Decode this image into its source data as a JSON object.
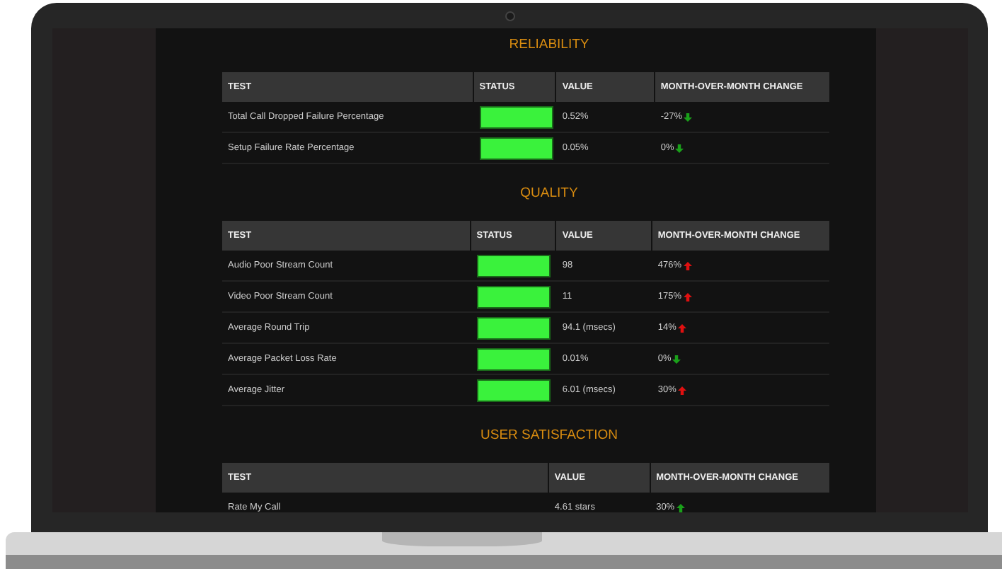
{
  "sections": [
    {
      "title": "RELIABILITY",
      "columns": [
        {
          "label": "TEST",
          "kind": "test"
        },
        {
          "label": "STATUS",
          "kind": "status"
        },
        {
          "label": "VALUE",
          "kind": "value"
        },
        {
          "label": "MONTH-OVER-MONTH CHANGE",
          "kind": "change"
        }
      ],
      "rows": [
        {
          "test": "Total Call Dropped Failure Percentage",
          "passing": true,
          "value": "0.52%",
          "change": "-27%",
          "rising": false,
          "good": true
        },
        {
          "test": "Setup Failure Rate Percentage",
          "passing": true,
          "value": "0.05%",
          "change": "0%",
          "rising": false,
          "good": true
        }
      ]
    },
    {
      "title": "QUALITY",
      "columns": [
        {
          "label": "TEST",
          "kind": "test"
        },
        {
          "label": "STATUS",
          "kind": "status"
        },
        {
          "label": "VALUE",
          "kind": "value"
        },
        {
          "label": "MONTH-OVER-MONTH CHANGE",
          "kind": "change"
        }
      ],
      "rows": [
        {
          "test": "Audio Poor Stream Count",
          "passing": true,
          "value": "98",
          "change": "476%",
          "rising": true,
          "good": false
        },
        {
          "test": "Video Poor Stream Count",
          "passing": true,
          "value": "11",
          "change": "175%",
          "rising": true,
          "good": false
        },
        {
          "test": "Average Round Trip",
          "passing": true,
          "value": "94.1 (msecs)",
          "change": "14%",
          "rising": true,
          "good": false
        },
        {
          "test": "Average Packet Loss Rate",
          "passing": true,
          "value": "0.01%",
          "change": "0%",
          "rising": false,
          "good": true
        },
        {
          "test": "Average Jitter",
          "passing": true,
          "value": "6.01 (msecs)",
          "change": "30%",
          "rising": true,
          "good": false
        }
      ]
    },
    {
      "title": "USER SATISFACTION",
      "columns": [
        {
          "label": "TEST",
          "kind": "test"
        },
        {
          "label": "VALUE",
          "kind": "value"
        },
        {
          "label": "MONTH-OVER-MONTH CHANGE",
          "kind": "change"
        }
      ],
      "rows": [
        {
          "test": "Rate My Call",
          "value": "4.61 stars",
          "change": "30%",
          "rising": true,
          "good": true
        }
      ]
    }
  ]
}
